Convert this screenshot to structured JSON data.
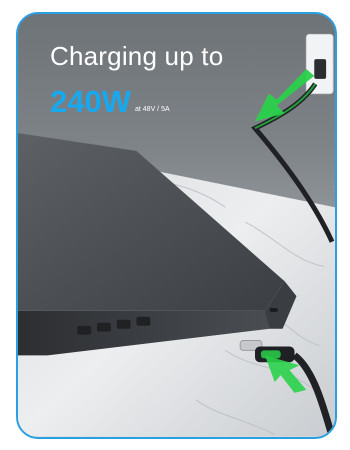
{
  "headline": "Charging up to",
  "power_value": "240",
  "power_unit": "W",
  "power_note": "at 48V / 5A",
  "colors": {
    "accent_blue": "#17a9ef",
    "frame_border": "#2a9fe2",
    "arrow_green": "#2ad14a"
  },
  "icons": [
    "green-arrow-icon"
  ]
}
